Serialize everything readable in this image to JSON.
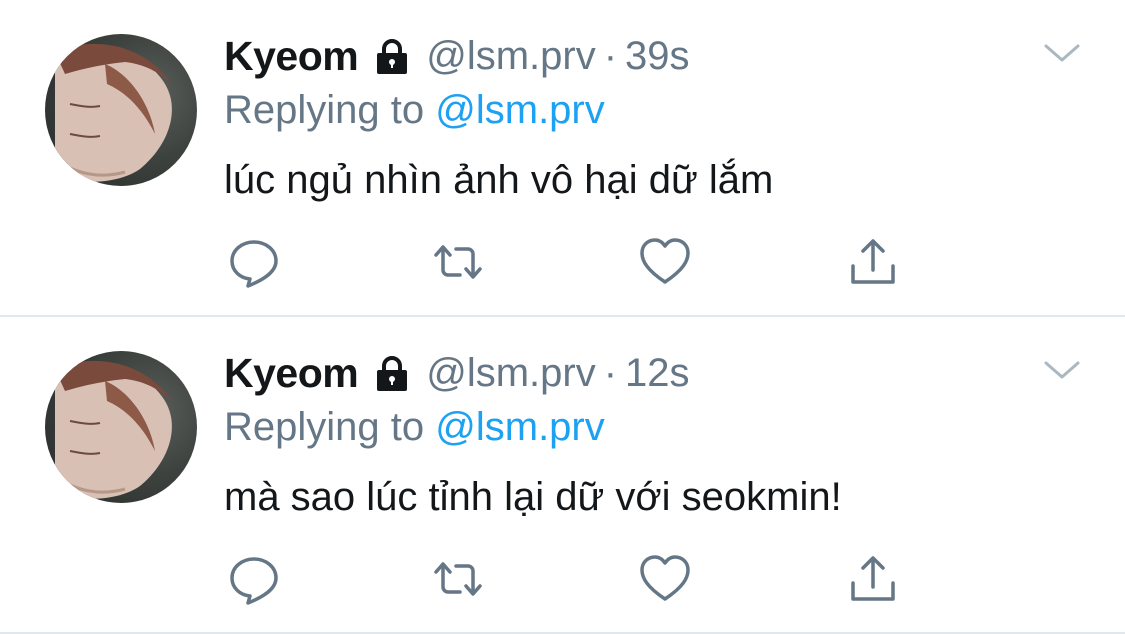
{
  "tweets": [
    {
      "display_name": "Kyeom",
      "handle": "@lsm.prv",
      "separator": "·",
      "time": "39s",
      "replying_prefix": "Replying to",
      "replying_to": "@lsm.prv",
      "text": "lúc ngủ nhìn ảnh vô hại dữ lắm",
      "icons": {
        "lock": "lock-icon",
        "menu": "chevron-down-icon",
        "reply": "reply-icon",
        "retweet": "retweet-icon",
        "like": "heart-icon",
        "share": "share-icon"
      }
    },
    {
      "display_name": "Kyeom",
      "handle": "@lsm.prv",
      "separator": "·",
      "time": "12s",
      "replying_prefix": "Replying to",
      "replying_to": "@lsm.prv",
      "text": "mà sao lúc tỉnh lại dữ với seokmin!",
      "icons": {
        "lock": "lock-icon",
        "menu": "chevron-down-icon",
        "reply": "reply-icon",
        "retweet": "retweet-icon",
        "like": "heart-icon",
        "share": "share-icon"
      }
    }
  ],
  "colors": {
    "text": "#14171a",
    "secondary": "#657786",
    "mention": "#1da1f2",
    "icon": "#657786",
    "divider": "#e1e8ed"
  }
}
